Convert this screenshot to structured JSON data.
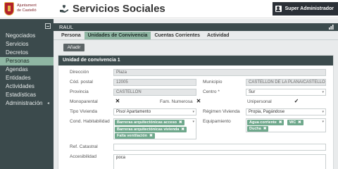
{
  "header": {
    "logo_text_line1": "Ajuntament",
    "logo_text_line2": "de Castelló",
    "app_title": "Servicios Sociales",
    "user_label": "Super Administrador",
    "icon": "hand-heart-icon"
  },
  "sidebar": {
    "items": [
      {
        "label": "Negociados"
      },
      {
        "label": "Servicios"
      },
      {
        "label": "Decretos"
      },
      {
        "label": "Personas",
        "active": true
      },
      {
        "label": "Agendas"
      },
      {
        "label": "Entidades"
      },
      {
        "label": "Actividades"
      },
      {
        "label": "Estadísticas"
      },
      {
        "label": "Administración",
        "has_submenu": true
      }
    ]
  },
  "main": {
    "person_name": "RAUL",
    "tabs": [
      "Persona",
      "Unidades de Convivencia",
      "Cuentas Corrientes",
      "Actividad"
    ],
    "active_tab": "Unidades de Convivencia",
    "add_button": "Añadir"
  },
  "panel": {
    "title": "Unidad de convivencia 1",
    "labels": {
      "direccion": "Dirección",
      "cod_postal": "Cód. postal",
      "municipio": "Municipio",
      "provincia": "Provincia",
      "centro": "Centro *",
      "monoparental": "Monoparental",
      "fam_numerosa": "Fam. Numerosa",
      "unipersonal": "Unipersonal",
      "tipo_vivienda": "Tipo Vivienda",
      "regimen_vivienda": "Régimen Vivienda",
      "cond_habitabilidad": "Cond. Habitabilidad",
      "equipamiento": "Equipamiento",
      "ref_catastral": "Ref. Catastral",
      "accesibilidad": "Accesibilidad"
    },
    "values": {
      "direccion": "Plaza",
      "cod_postal": "12005",
      "municipio": "CASTELLON DE LA PLANA/CASTELLO DE LA P",
      "provincia": "CASTELLON",
      "centro": "Sur",
      "monoparental": "✕",
      "fam_numerosa": "✕",
      "unipersonal": "✓",
      "tipo_vivienda": "Piso/ Apartamento",
      "regimen_vivienda": "Propia, Pagándose",
      "ref_catastral": "",
      "accesibilidad": "poca"
    },
    "cond_habitabilidad_chips": [
      "Barreras arquitectónicas acceso",
      "Barreras arquitectónicas vivienda",
      "Falta ventilación"
    ],
    "equipamiento_chips": [
      "Agua corriente",
      "WC",
      "Ducha"
    ],
    "chip_remove_glyph": "✖",
    "select_arrow_glyph": "▾"
  }
}
